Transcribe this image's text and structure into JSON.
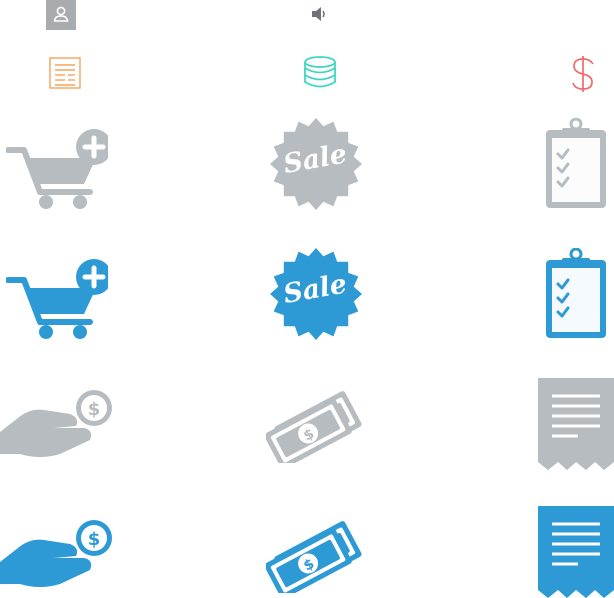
{
  "colors": {
    "gray": "#b7bcc1",
    "gray_light": "#cfd3d7",
    "gray_dark": "#9ba1a7",
    "blue": "#2d9ad6",
    "blue_light": "#4fb3ea",
    "blue_dark": "#1f7fb6",
    "top_user_bg": "#a9acaf",
    "orange": "#f5a25a",
    "teal": "#3fd6c0",
    "red": "#f06a6a"
  },
  "icons": {
    "top": [
      "user-icon",
      "speaker-icon"
    ],
    "line": [
      "document-icon",
      "coins-icon",
      "dollar-icon"
    ],
    "rows": [
      [
        "cart-add-icon-gray",
        "sale-badge-icon-gray",
        "clipboard-checklist-icon-gray"
      ],
      [
        "cart-add-icon-blue",
        "sale-badge-icon-blue",
        "clipboard-checklist-icon-blue"
      ],
      [
        "hand-coin-icon-gray",
        "banknotes-icon-gray",
        "receipt-icon-gray"
      ],
      [
        "hand-coin-icon-blue",
        "banknotes-icon-blue",
        "receipt-icon-blue"
      ]
    ]
  },
  "sale": {
    "badge_gray": "Sale",
    "badge_blue": "Sale"
  }
}
